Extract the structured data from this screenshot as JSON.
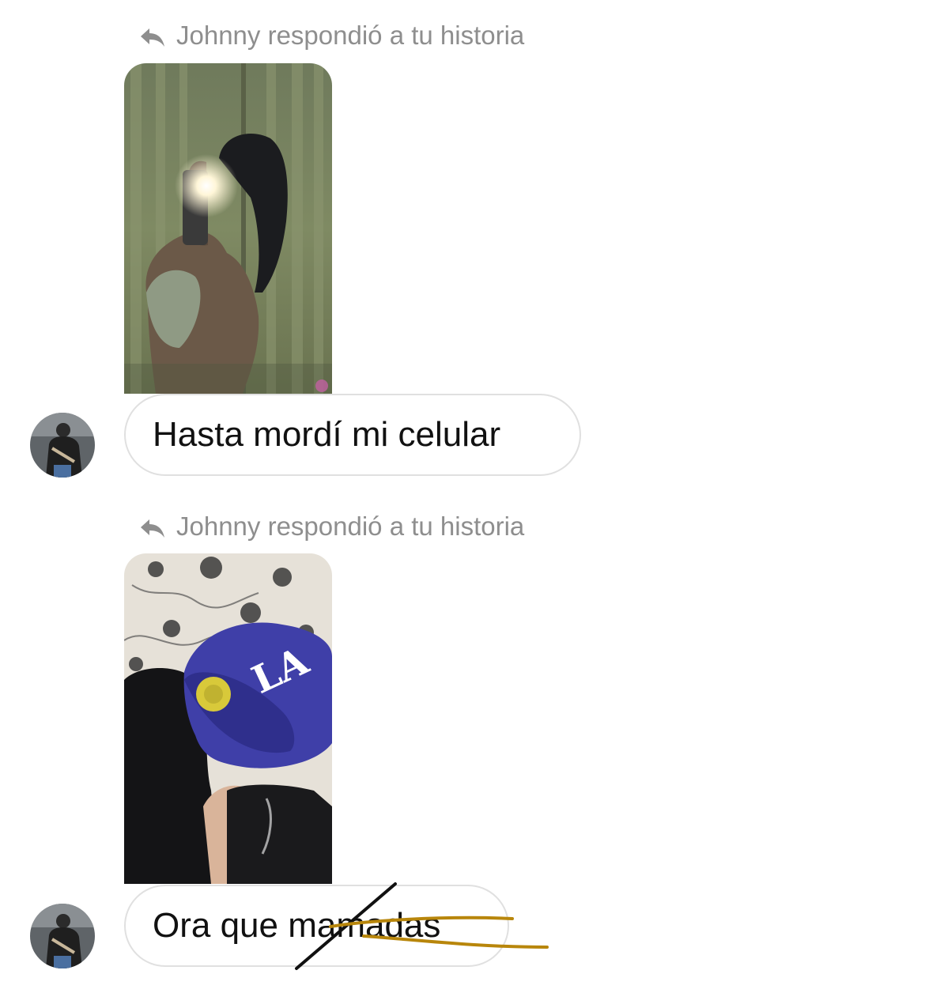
{
  "messages": [
    {
      "reply_label": "Johnny respondió a tu historia",
      "reply_icon": "reply-arrow-icon",
      "story_image": "story-thumbnail-mirror-selfie",
      "text": "Hasta mordí mi celular",
      "avatar": "avatar-johnny"
    },
    {
      "reply_label": "Johnny respondió a tu historia",
      "reply_icon": "reply-arrow-icon",
      "story_image": "story-thumbnail-couple-cap",
      "text": "Ora que mamadas",
      "avatar": "avatar-johnny"
    }
  ],
  "colors": {
    "meta_text": "#8e8e8e",
    "bubble_border": "#e0e0e0",
    "message_text": "#111111",
    "scribble_black": "#111111",
    "scribble_gold": "#b8860b"
  }
}
